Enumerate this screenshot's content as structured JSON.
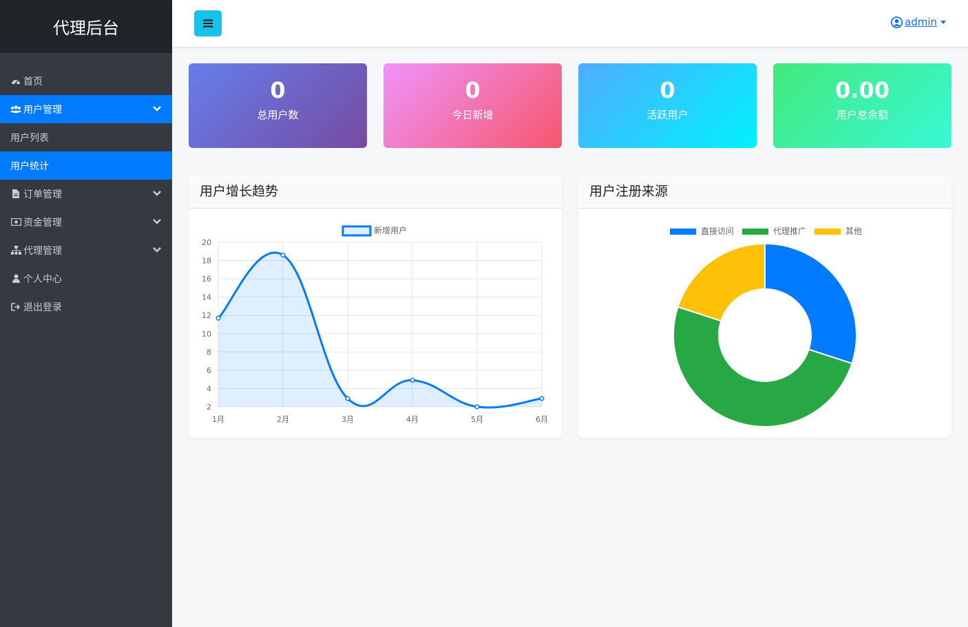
{
  "sidebar": {
    "brand": "代理后台",
    "items": [
      {
        "label": "首页"
      },
      {
        "label": "用户管理"
      },
      {
        "label": "用户列表"
      },
      {
        "label": "用户统计"
      },
      {
        "label": "订单管理"
      },
      {
        "label": "资金管理"
      },
      {
        "label": "代理管理"
      },
      {
        "label": "个人中心"
      },
      {
        "label": "退出登录"
      }
    ]
  },
  "topbar": {
    "user": "admin"
  },
  "stats": [
    {
      "value": "0",
      "label": "总用户数"
    },
    {
      "value": "0",
      "label": "今日新增"
    },
    {
      "value": "0",
      "label": "活跃用户"
    },
    {
      "value": "0.00",
      "label": "用户总余额"
    }
  ],
  "panels": {
    "growth_title": "用户增长趋势",
    "source_title": "用户注册来源"
  },
  "colors": {
    "accent": "#007bff",
    "green": "#28a745",
    "yellow": "#ffc107"
  },
  "chart_data": [
    {
      "type": "line",
      "categories": [
        "1月",
        "2月",
        "3月",
        "4月",
        "5月",
        "6月"
      ],
      "series": [
        {
          "name": "新增用户",
          "values": [
            11.7,
            18.6,
            2.9,
            4.9,
            2.0,
            2.9
          ],
          "color": "#007bff"
        }
      ],
      "ylim": [
        2,
        20
      ],
      "yticks": [
        2,
        4,
        6,
        8,
        10,
        12,
        14,
        16,
        18,
        20
      ],
      "grid": true,
      "legend": "top",
      "area_fill": true
    },
    {
      "type": "pie",
      "donut": true,
      "labels": [
        "直接访问",
        "代理推广",
        "其他"
      ],
      "values": [
        30,
        50,
        20
      ],
      "colors": [
        "#007bff",
        "#28a745",
        "#ffc107"
      ],
      "legend": "top"
    }
  ]
}
